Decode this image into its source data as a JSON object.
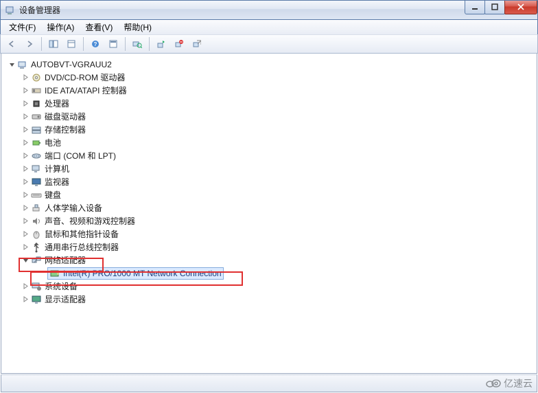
{
  "window": {
    "title": "设备管理器"
  },
  "menu": {
    "file": "文件(F)",
    "action": "操作(A)",
    "view": "查看(V)",
    "help": "帮助(H)"
  },
  "tree": {
    "root": "AUTOBVT-VGRAUU2",
    "items": [
      {
        "label": "DVD/CD-ROM 驱动器",
        "icon": "disc"
      },
      {
        "label": "IDE ATA/ATAPI 控制器",
        "icon": "ide"
      },
      {
        "label": "处理器",
        "icon": "cpu"
      },
      {
        "label": "磁盘驱动器",
        "icon": "disk"
      },
      {
        "label": "存储控制器",
        "icon": "storage"
      },
      {
        "label": "电池",
        "icon": "battery"
      },
      {
        "label": "端口 (COM 和 LPT)",
        "icon": "port"
      },
      {
        "label": "计算机",
        "icon": "computer"
      },
      {
        "label": "监视器",
        "icon": "monitor"
      },
      {
        "label": "键盘",
        "icon": "keyboard"
      },
      {
        "label": "人体学输入设备",
        "icon": "hid"
      },
      {
        "label": "声音、视频和游戏控制器",
        "icon": "sound"
      },
      {
        "label": "鼠标和其他指针设备",
        "icon": "mouse"
      },
      {
        "label": "通用串行总线控制器",
        "icon": "usb"
      }
    ],
    "network_adapter_label": "网络适配器",
    "network_device": "Intel(R) PRO/1000 MT Network Connection",
    "tail": [
      {
        "label": "系统设备",
        "icon": "system"
      },
      {
        "label": "显示适配器",
        "icon": "display"
      }
    ]
  },
  "watermark": "亿速云"
}
